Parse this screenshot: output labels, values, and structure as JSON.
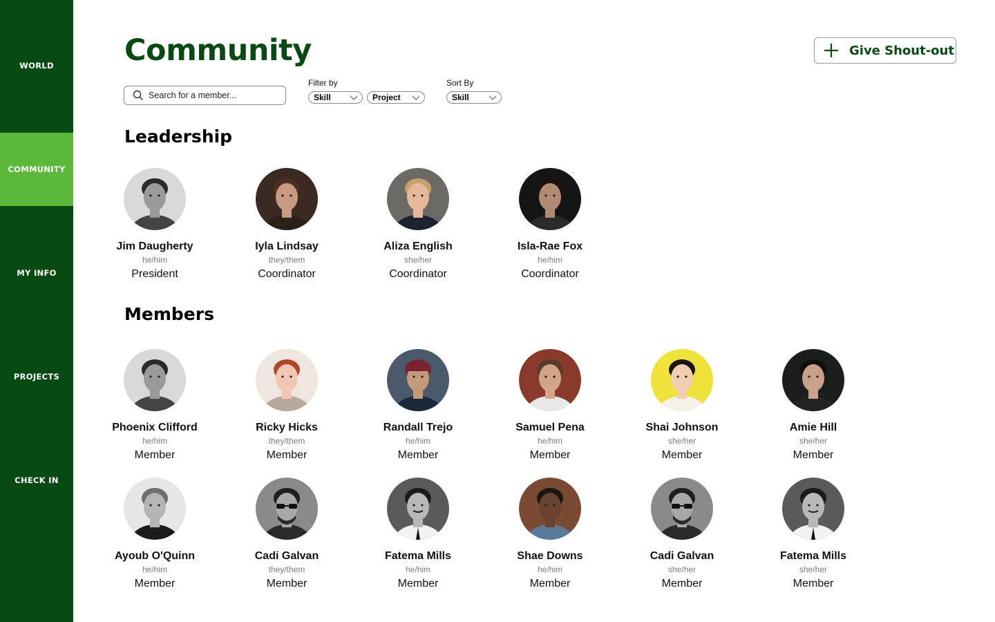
{
  "nav": [
    {
      "label": "WORLD"
    },
    {
      "label": "COMMUNITY"
    },
    {
      "label": "MY INFO"
    },
    {
      "label": "PROJECTS"
    },
    {
      "label": "CHECK IN"
    }
  ],
  "nav_active": "COMMUNITY",
  "page_title": "Community",
  "shoutout_button": {
    "label": "Give Shout-out",
    "icon": "plus-icon"
  },
  "search": {
    "placeholder": "Search for a member...",
    "icon": "search-icon"
  },
  "filter": {
    "label": "Filter by",
    "options": [
      "Skill",
      "Project"
    ]
  },
  "sort": {
    "label": "Sort By",
    "value": "Skill"
  },
  "colors": {
    "sidebar": "#074a12",
    "active_nav": "#5cb83a",
    "title": "#074a12"
  },
  "leadership": {
    "title": "Leadership",
    "people": [
      {
        "name": "Jim Daugherty",
        "pronouns": "he/him",
        "role": "President",
        "photo": "bw"
      },
      {
        "name": "Iyla Lindsay",
        "pronouns": "they/them",
        "role": "Coordinator",
        "photo": "warm"
      },
      {
        "name": "Aliza English",
        "pronouns": "she/her",
        "role": "Coordinator",
        "photo": "blonde"
      },
      {
        "name": "Isla-Rae Fox",
        "pronouns": "he/him",
        "role": "Coordinator",
        "photo": "dark"
      }
    ]
  },
  "members": {
    "title": "Members",
    "people": [
      {
        "name": "Phoenix Clifford",
        "pronouns": "he/him",
        "role": "Member",
        "photo": "bw"
      },
      {
        "name": "Ricky Hicks",
        "pronouns": "they/them",
        "role": "Member",
        "photo": "redhead"
      },
      {
        "name": "Randall Trejo",
        "pronouns": "he/him",
        "role": "Member",
        "photo": "beanie"
      },
      {
        "name": "Samuel Pena",
        "pronouns": "he/him",
        "role": "Member",
        "photo": "brick"
      },
      {
        "name": "Shai Johnson",
        "pronouns": "she/her",
        "role": "Member",
        "photo": "yellow"
      },
      {
        "name": "Amie Hill",
        "pronouns": "she/her",
        "role": "Member",
        "photo": "darkhair"
      },
      {
        "name": "Ayoub O'Quinn",
        "pronouns": "he/him",
        "role": "Member",
        "photo": "bwlight"
      },
      {
        "name": "Cadi Galvan",
        "pronouns": "they/them",
        "role": "Member",
        "photo": "sunglasses"
      },
      {
        "name": "Fatema Mills",
        "pronouns": "he/him",
        "role": "Member",
        "photo": "tie"
      },
      {
        "name": "Shae Downs",
        "pronouns": "he/him",
        "role": "Member",
        "photo": "curly"
      },
      {
        "name": "Cadi Galvan",
        "pronouns": "she/her",
        "role": "Member",
        "photo": "sunglasses"
      },
      {
        "name": "Fatema Mills",
        "pronouns": "she/her",
        "role": "Member",
        "photo": "tie"
      }
    ]
  }
}
